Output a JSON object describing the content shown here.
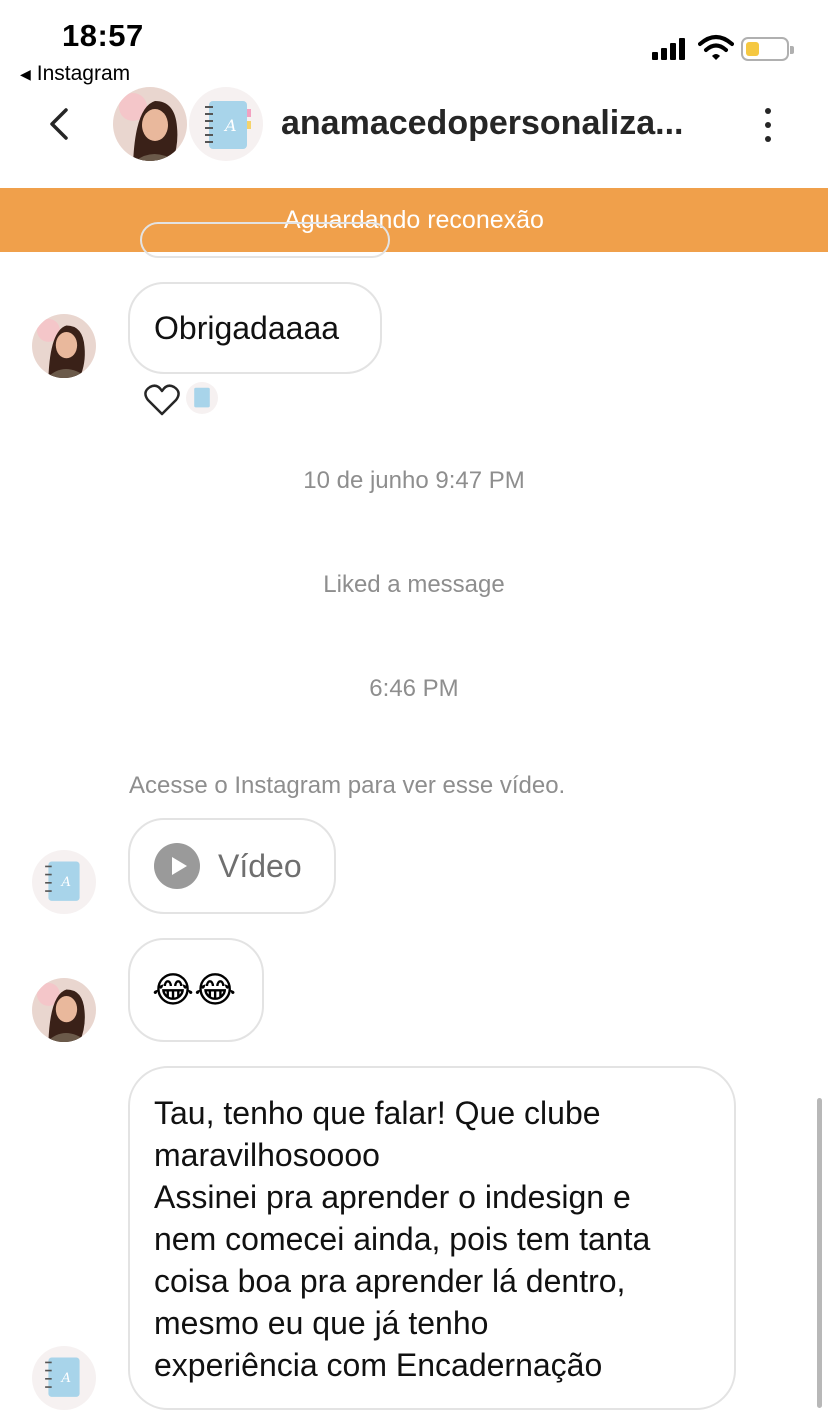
{
  "status_bar": {
    "time": "18:57",
    "back_app_label": "Instagram"
  },
  "header": {
    "title": "anamacedopersonaliza...",
    "back_icon": "chevron-left-icon",
    "more_icon": "more-vertical-icon"
  },
  "banner": {
    "text": "Aguardando reconexão",
    "color": "#f0a04b"
  },
  "messages": {
    "obrigada": "Obrigadaaaa",
    "timestamp_1": "10 de junho 9:47 PM",
    "liked_note": "Liked a message",
    "timestamp_2": "6:46 PM",
    "video_note": "Acesse o Instagram para ver esse vídeo.",
    "video_label": "Vídeo",
    "emoji": "😂😂",
    "long_lines": [
      "Tau, tenho que falar! Que clube",
      "maravilhosoooo",
      "Assinei pra aprender o indesign e",
      "nem comecei ainda, pois tem tanta",
      "coisa boa pra aprender lá dentro,",
      "mesmo eu que já tenho",
      "experiência com Encadernação"
    ]
  }
}
